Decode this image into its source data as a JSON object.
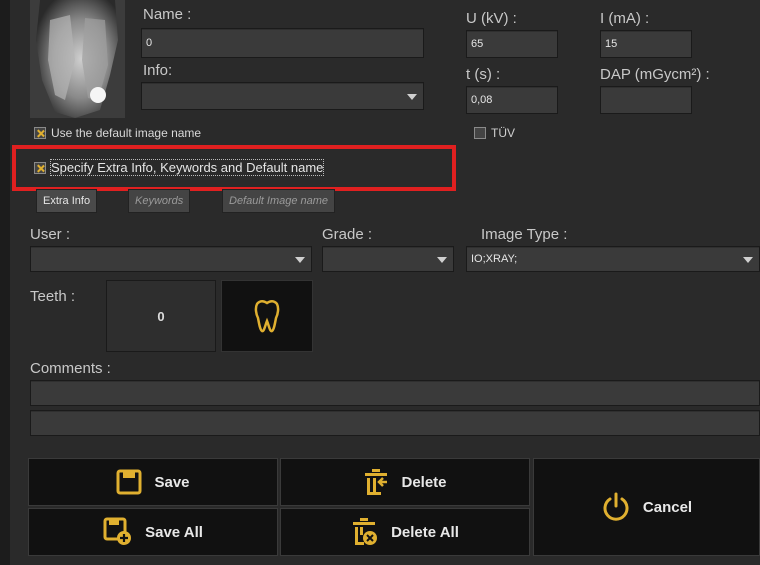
{
  "image_info": {
    "name_label": "Name :",
    "name_value": "0",
    "info_label": "Info:",
    "info_value": ""
  },
  "exposure": {
    "u_label": "U (kV) :",
    "u_value": "65",
    "i_label": "I (mA) :",
    "i_value": "15",
    "t_label": "t (s) :",
    "t_value": "0,08",
    "dap_label": "DAP (mGycm²) :",
    "dap_value": ""
  },
  "options": {
    "default_name_label": "Use the default image name",
    "default_name_checked": true,
    "tuv_label": "TÜV",
    "tuv_checked": false,
    "specify_label": "Specify Extra Info, Keywords and Default name",
    "specify_checked": true
  },
  "tabs": [
    {
      "label": "Extra Info",
      "active": true
    },
    {
      "label": "Keywords",
      "active": false
    },
    {
      "label": "Default Image name",
      "active": false
    }
  ],
  "selectors": {
    "user_label": "User :",
    "user_value": "",
    "grade_label": "Grade :",
    "grade_value": "",
    "image_type_label": "Image Type :",
    "image_type_value": "IO;XRAY;"
  },
  "teeth": {
    "label": "Teeth :",
    "value": "0",
    "icon": "tooth-icon"
  },
  "comments": {
    "label": "Comments :",
    "line1": "",
    "line2": ""
  },
  "buttons": {
    "save": "Save",
    "save_all": "Save All",
    "delete": "Delete",
    "delete_all": "Delete All",
    "cancel": "Cancel"
  },
  "colors": {
    "accent": "#e0b030",
    "highlight": "#e02020",
    "background": "#2a2a2a"
  }
}
